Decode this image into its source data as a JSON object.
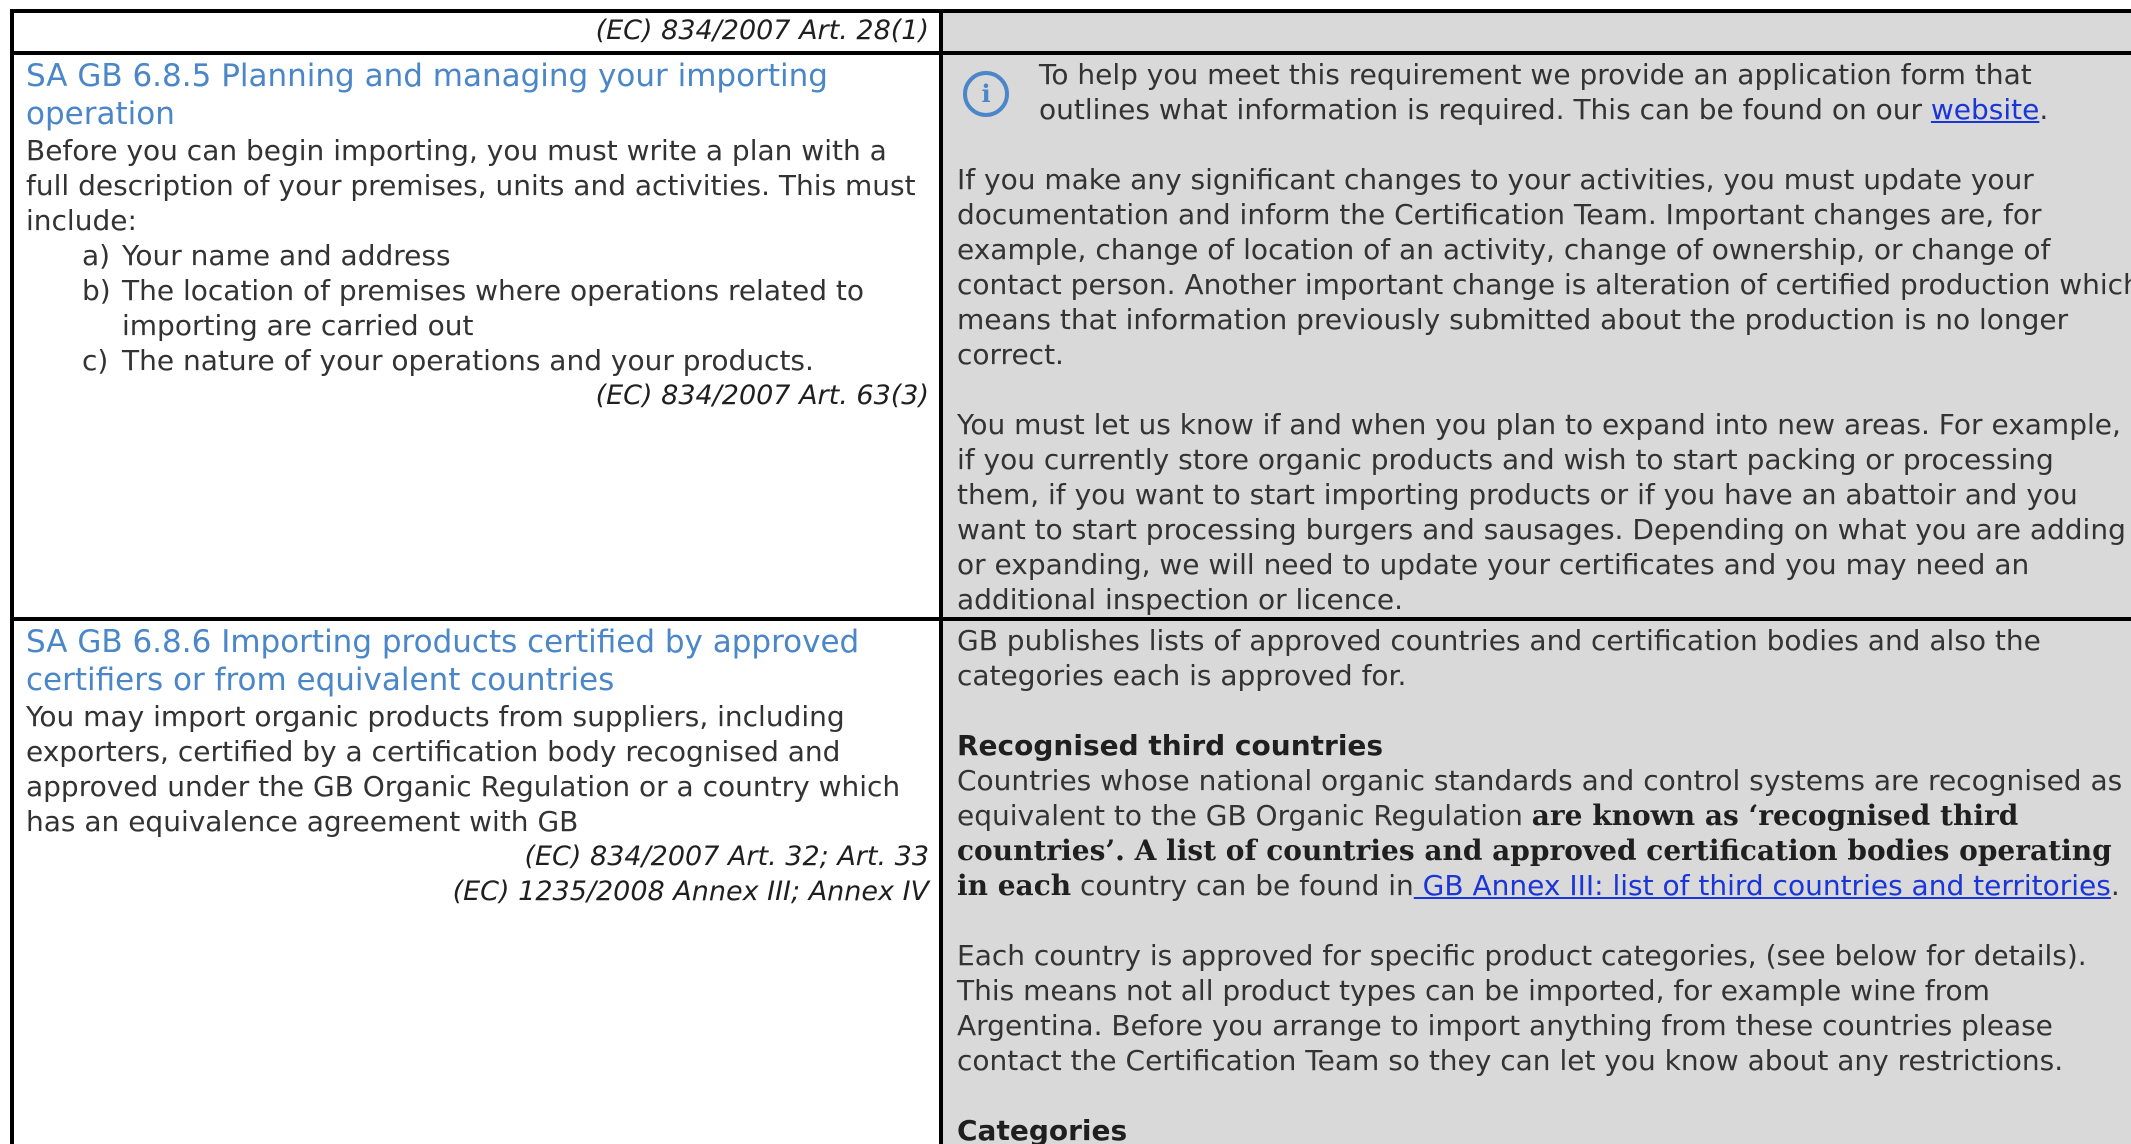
{
  "row1": {
    "left_ref": "(EC) 834/2007 Art. 28(1)",
    "right_text": ""
  },
  "section_685": {
    "heading": "SA GB 6.8.5 Planning and managing your importing operation",
    "intro": "Before you can begin importing, you must write a plan with a full description of your premises, units and activities. This must include:",
    "items": [
      {
        "marker": "a)",
        "text": "Your name and address"
      },
      {
        "marker": "b)",
        "text": "The location of premises where operations related to importing are carried out"
      },
      {
        "marker": "c)",
        "text": "The nature of your operations and your products."
      }
    ],
    "ref": "(EC) 834/2007 Art. 63(3)",
    "info_icon": "info-icon",
    "info_text": "To help you meet this requirement we provide an application form that outlines what information is required. This can be found on our ",
    "info_link": "website",
    "info_end": ".",
    "para1": "If you make any significant changes to your activities, you must update your documentation and inform the Certification Team. Important changes are, for example, change of location of an activity, change of ownership, or change of contact person. Another important change is alteration of certified production which means that information previously submitted about the production is no longer correct.",
    "para2": "You must let us know if and when you plan to expand into new areas. For example, if you currently store organic products and wish to start packing or processing them, if you want to start importing products or if you have an abattoir and you want to start processing burgers and sausages. Depending on what you are adding or expanding, we will need to update your certificates and you may need an additional inspection or licence."
  },
  "section_686": {
    "heading": "SA GB 6.8.6 Importing products certified by approved certifiers or from equivalent countries",
    "body": "You may import organic products from suppliers, including exporters, certified by a certification body recognised and approved under the GB Organic Regulation or a country which has an equivalence agreement with GB",
    "ref1": "(EC) 834/2007 Art. 32; Art. 33",
    "ref2": "(EC) 1235/2008 Annex III; Annex IV",
    "right_intro": "GB publishes lists of approved countries and certification bodies and also the categories each is approved for.",
    "sub1": "Recognised third countries",
    "rec_text1": "Countries whose national organic standards and control systems are recognised as equivalent to the GB Organic Regulation ",
    "rec_bold": "are known as ‘recognised third countries’. A list of countries and approved certification bodies operating in each",
    "rec_text2": " country can be found in",
    "rec_link": " GB Annex III: list of third countries and territories",
    "rec_end": ".",
    "para3": "Each country is approved for specific product categories, (see below for details). This means not all product types can be imported, for example wine from Argentina. Before you arrange to import anything from these countries please contact the Certification Team so they can let you know about any restrictions.",
    "sub2": "Categories"
  },
  "colors": {
    "heading": "#4a86c8",
    "right_cell_bg": "#d9d9d9",
    "link": "#1a35d8",
    "border": "#000000"
  }
}
